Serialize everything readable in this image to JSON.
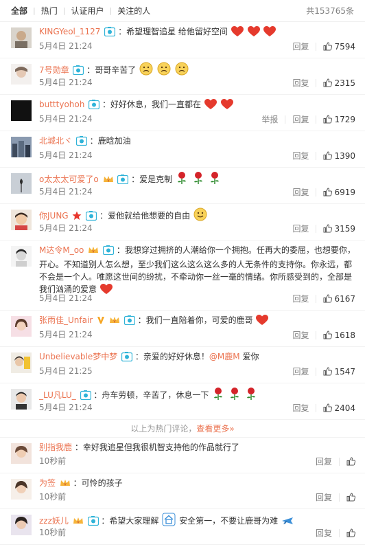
{
  "tabs": [
    {
      "label": "全部",
      "active": true
    },
    {
      "label": "热门",
      "active": false
    },
    {
      "label": "认证用户",
      "active": false
    },
    {
      "label": "关注的人",
      "active": false
    }
  ],
  "total_label": "共153765条",
  "actions": {
    "reply": "回复",
    "report": "举报"
  },
  "hot_comments": [
    {
      "name": "KINGYeol_1127",
      "text": "：希望理智追星 给他留好空间",
      "time": "5月4日 21:24",
      "likes": "7594"
    },
    {
      "name": "7号勋章",
      "text": "：哥哥辛苦了",
      "time": "5月4日 21:24",
      "likes": "2315"
    },
    {
      "name": "butttyohoh",
      "text": "：好好休息，我们一直都在",
      "time": "5月4日 21:24",
      "likes": "1729",
      "report": true
    },
    {
      "name": "北城北ヾ",
      "text": "：鹿晗加油",
      "time": "5月4日 21:24",
      "likes": "1390"
    },
    {
      "name": "o太太太可爱了o",
      "text": "：爱是克制",
      "time": "5月4日 21:24",
      "likes": "6919"
    },
    {
      "name": "你JUNG",
      "text": "：爱他就给他想要的自由",
      "time": "5月4日 21:24",
      "likes": "3159"
    },
    {
      "name": "M达令M_oo",
      "line1": "：我想穿过拥挤的人潮给你一个拥抱。任再大的委屈，也想要你，",
      "line2": "开心。不知道别人怎么想，至少我们这么这么这么多的人无条件的支持你。你永远，都",
      "line3": "不会是一个人。唯愿这世间的纷扰，不牵动你一丝一毫的情绪。你所感受到的，全部是",
      "line4": "我们汹涌的爱意",
      "time": "5月4日 21:24",
      "likes": "6167"
    },
    {
      "name": "张雨佳_Unfair",
      "text": "：我们一直陪着你，可爱的鹿哥",
      "time": "5月4日 21:24",
      "likes": "1618"
    },
    {
      "name": "Unbelievable梦中梦",
      "text": "：亲爱的好好休息！",
      "mention": "@M鹿M",
      "text_after": " 爱你",
      "time": "5月4日 21:25",
      "likes": "1547"
    },
    {
      "name": "_LU凡LU_",
      "text": "：舟车劳顿，辛苦了，休息一下",
      "time": "5月4日 21:24",
      "likes": "2404"
    }
  ],
  "hot_footer": {
    "text": "以上为热门评论，",
    "link": "查看更多»"
  },
  "recent_comments": [
    {
      "name": "别指我鹿",
      "text": "：幸好我追星但我很机智支持他的作品就行了",
      "time": "10秒前"
    },
    {
      "name": "为签",
      "text": "：可怜的孩子",
      "time": "10秒前"
    },
    {
      "name": "zzz妖儿",
      "text": "：希望大家理解",
      "text_after": "安全第一，不要让鹿哥为难",
      "time": "10秒前"
    }
  ],
  "colors": {
    "accent": "#eb7350",
    "badge": "#2fb3d8",
    "heart": "#e53a2d",
    "link": "#eb7350"
  }
}
